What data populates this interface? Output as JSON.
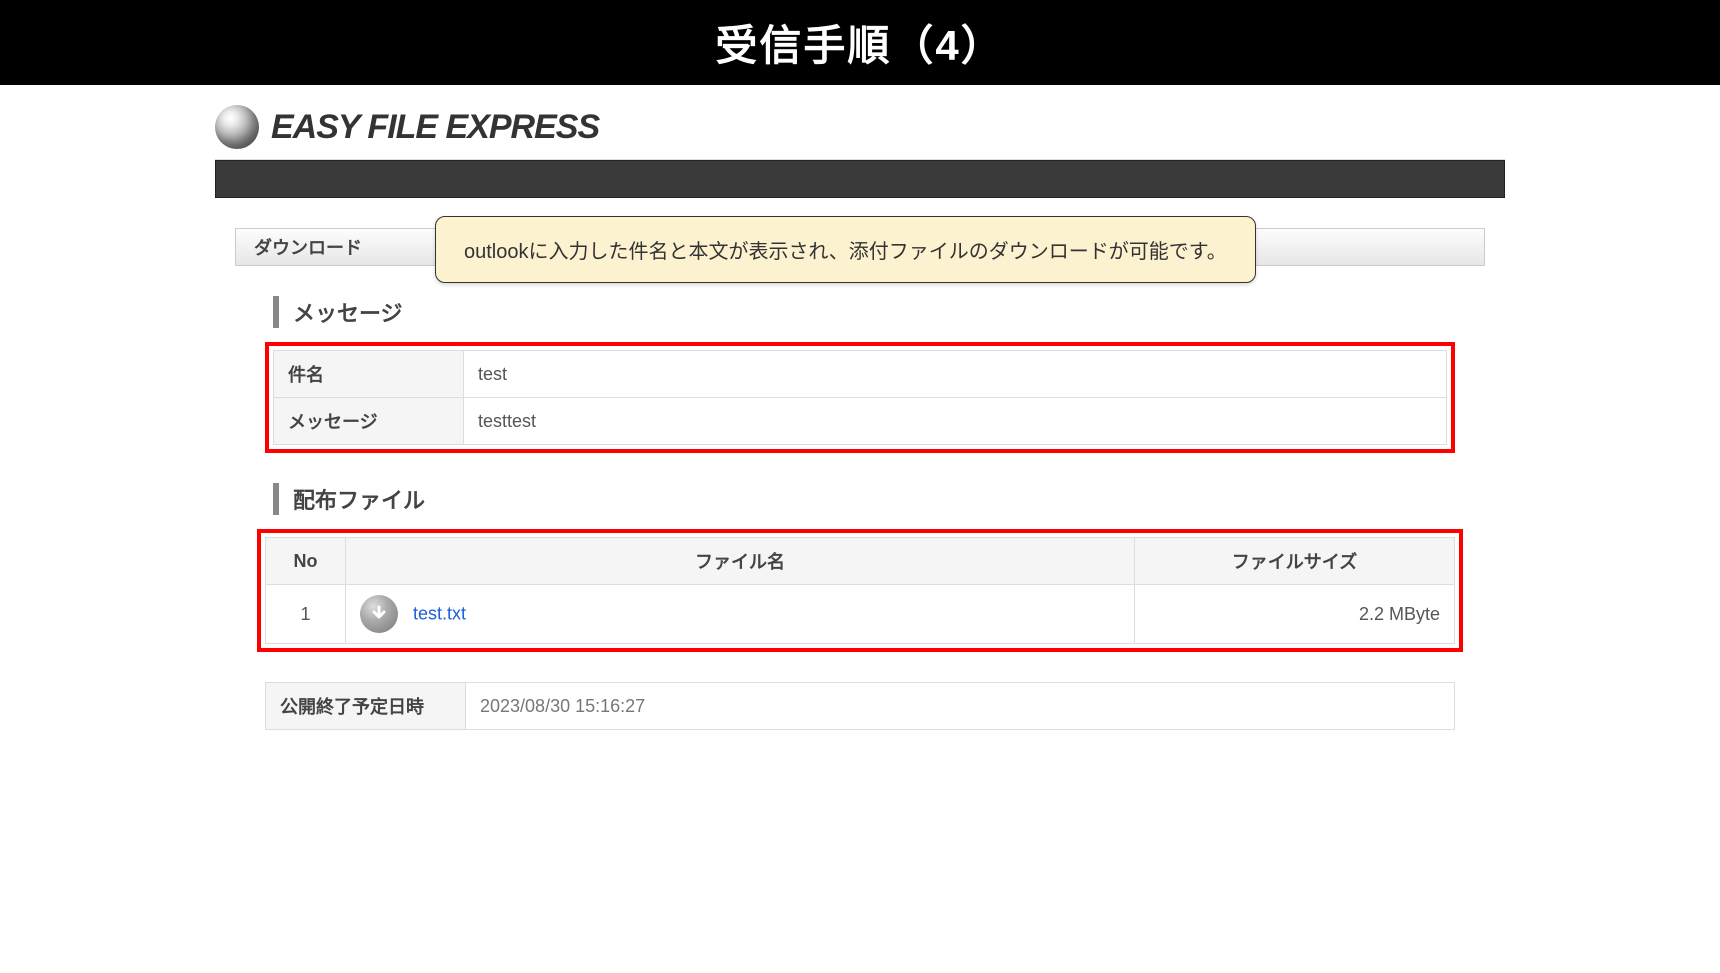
{
  "slide": {
    "title": "受信手順（4）"
  },
  "app": {
    "logo_text": "EASY FILE EXPRESS"
  },
  "tab": {
    "download_label": "ダウンロード"
  },
  "callout": {
    "text": "outlookに入力した件名と本文が表示され、添付ファイルのダウンロードが可能です。"
  },
  "message_section": {
    "heading": "メッセージ",
    "subject_label": "件名",
    "subject_value": "test",
    "message_label": "メッセージ",
    "message_value": "testtest"
  },
  "files_section": {
    "heading": "配布ファイル",
    "columns": {
      "no": "No",
      "name": "ファイル名",
      "size": "ファイルサイズ"
    },
    "rows": [
      {
        "no": "1",
        "name": "test.txt",
        "size": "2.2 MByte"
      }
    ]
  },
  "expiry": {
    "label": "公開終了予定日時",
    "value": "2023/08/30 15:16:27"
  }
}
